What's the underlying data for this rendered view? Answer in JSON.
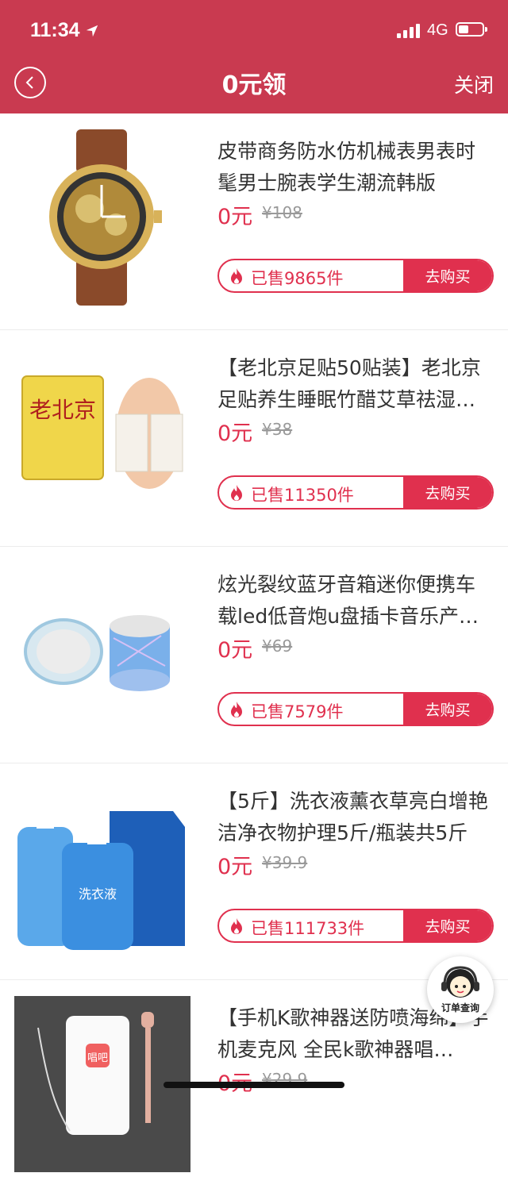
{
  "status_bar": {
    "time": "11:34",
    "network": "4G"
  },
  "header": {
    "title": "0元领",
    "close_label": "关闭"
  },
  "buy_label": "去购买",
  "products": [
    {
      "name": "皮带商务防水仿机械表男表时髦男士腕表学生潮流韩版",
      "price": "0元",
      "original_price": "¥108",
      "sold": "已售9865件"
    },
    {
      "name": "【老北京足贴50贴装】老北京足贴养生睡眠竹醋艾草祛湿…",
      "price": "0元",
      "original_price": "¥38",
      "sold": "已售11350件"
    },
    {
      "name": "炫光裂纹蓝牙音箱迷你便携车载led低音炮u盘插卡音乐产…",
      "price": "0元",
      "original_price": "¥69",
      "sold": "已售7579件"
    },
    {
      "name": "【5斤】洗衣液薰衣草亮白增艳洁净衣物护理5斤/瓶装共5斤",
      "price": "0元",
      "original_price": "¥39.9",
      "sold": "已售111733件"
    },
    {
      "name": "【手机K歌神器送防喷海绵】手机麦克风 全民k歌神器唱…",
      "price": "0元",
      "original_price": "¥29.9",
      "sold": ""
    }
  ],
  "images": {
    "insole_text": "老北京",
    "detergent_text": "洗衣液",
    "phone_app_text": "唱吧"
  },
  "float_button": {
    "label": "订单查询"
  },
  "colors": {
    "header": "#c93a50",
    "accent": "#e0304e"
  }
}
